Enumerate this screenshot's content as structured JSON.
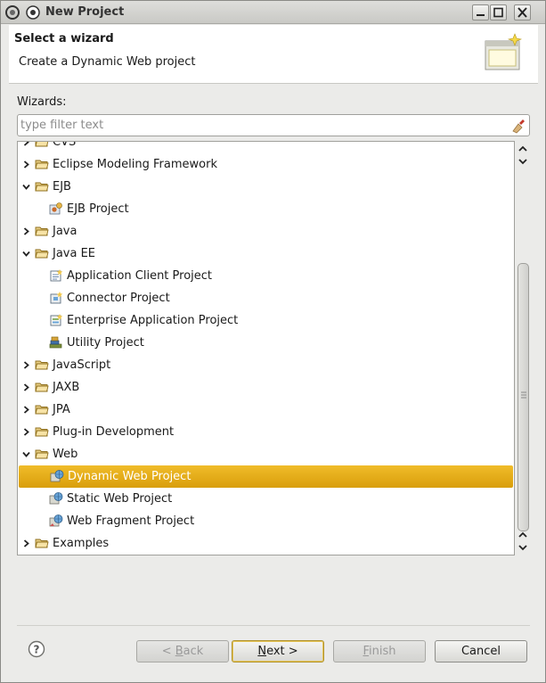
{
  "window": {
    "title": "New Project"
  },
  "banner": {
    "title": "Select a wizard",
    "description": "Create a Dynamic Web project"
  },
  "wizards": {
    "label": "Wizards:",
    "filter_placeholder": "type filter text"
  },
  "tree": {
    "items": [
      {
        "label": "CVS",
        "type": "folder",
        "expanded": false
      },
      {
        "label": "Eclipse Modeling Framework",
        "type": "folder",
        "expanded": false
      },
      {
        "label": "EJB",
        "type": "folder",
        "expanded": true
      },
      {
        "label": "EJB Project",
        "type": "ejb-project-icon"
      },
      {
        "label": "Java",
        "type": "folder",
        "expanded": false
      },
      {
        "label": "Java EE",
        "type": "folder",
        "expanded": true
      },
      {
        "label": "Application Client Project",
        "type": "app-client-icon"
      },
      {
        "label": "Connector Project",
        "type": "connector-icon"
      },
      {
        "label": "Enterprise Application Project",
        "type": "ear-icon"
      },
      {
        "label": "Utility Project",
        "type": "utility-icon"
      },
      {
        "label": "JavaScript",
        "type": "folder",
        "expanded": false
      },
      {
        "label": "JAXB",
        "type": "folder",
        "expanded": false
      },
      {
        "label": "JPA",
        "type": "folder",
        "expanded": false
      },
      {
        "label": "Plug-in Development",
        "type": "folder",
        "expanded": false
      },
      {
        "label": "Web",
        "type": "folder",
        "expanded": true
      },
      {
        "label": "Dynamic Web Project",
        "type": "web-project-icon",
        "selected": true
      },
      {
        "label": "Static Web Project",
        "type": "web-project-icon"
      },
      {
        "label": "Web Fragment Project",
        "type": "web-fragment-icon"
      },
      {
        "label": "Examples",
        "type": "folder",
        "expanded": false
      }
    ]
  },
  "buttons": {
    "back": {
      "pre": "< ",
      "mnemonic": "B",
      "post": "ack"
    },
    "next": {
      "mnemonic": "N",
      "post": "ext >"
    },
    "finish": {
      "mnemonic": "F",
      "post": "inish"
    },
    "cancel": "Cancel"
  },
  "colors": {
    "selection": "#e4a917",
    "window_bg": "#ebebe9"
  }
}
